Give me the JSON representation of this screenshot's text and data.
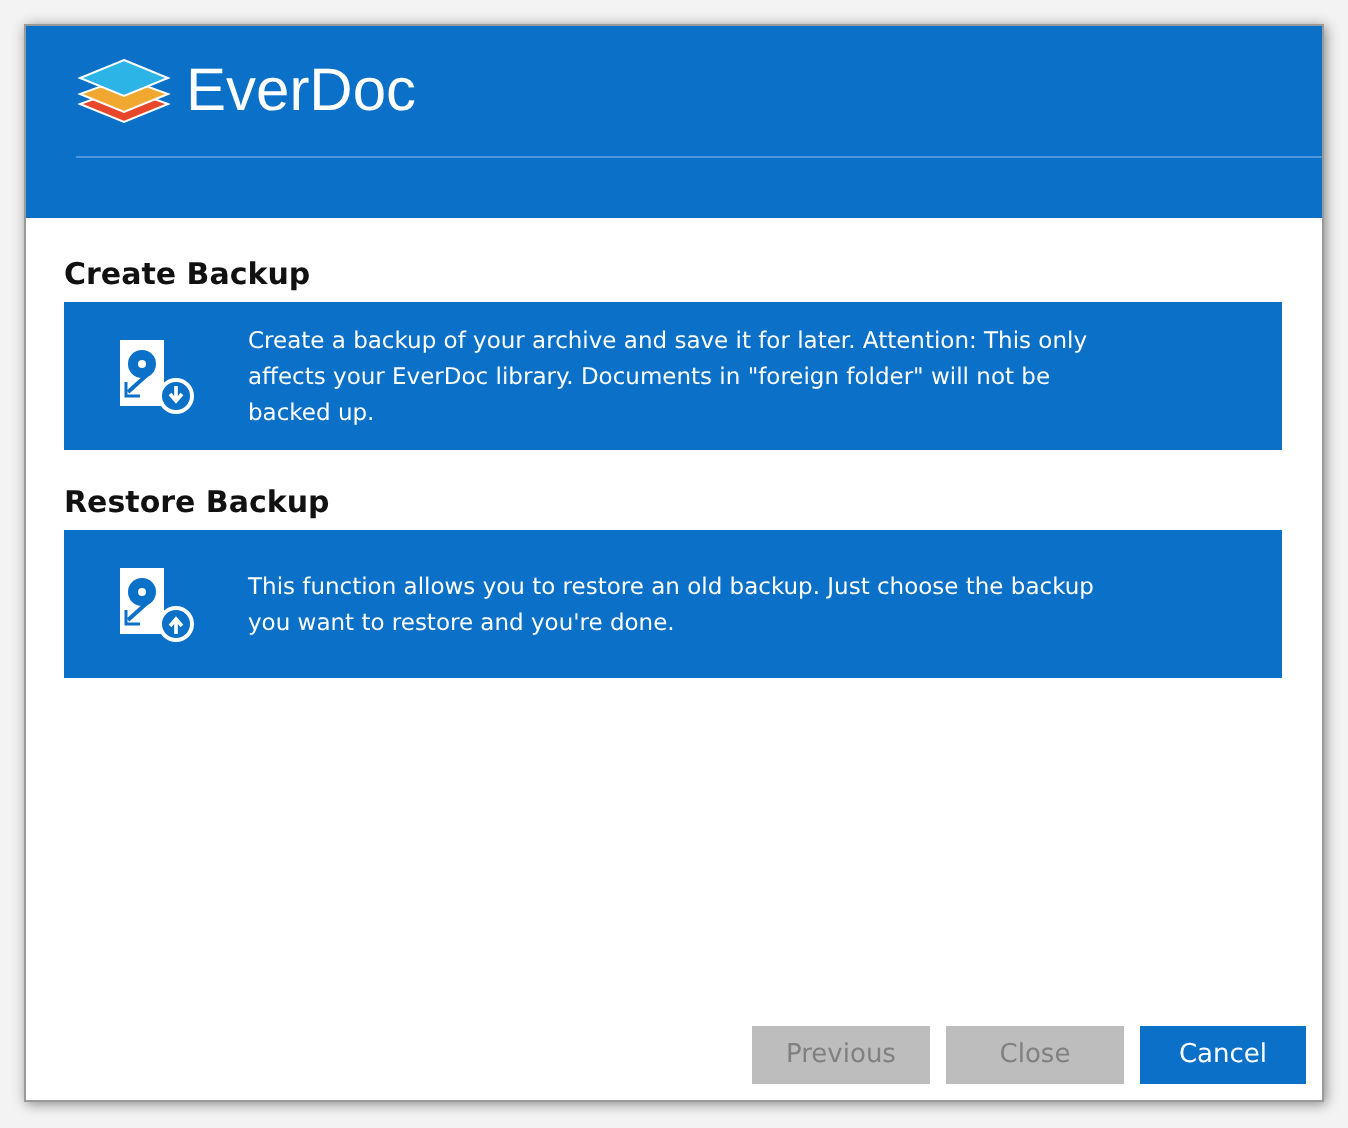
{
  "header": {
    "app_name": "EverDoc"
  },
  "sections": [
    {
      "kind": "backup",
      "title": "Create Backup",
      "description": "Create a backup of your archive and save it for later. Attention: This only affects your EverDoc library. Documents in \"foreign folder\" will not be backed up."
    },
    {
      "kind": "restore",
      "title": "Restore Backup",
      "description": "This function allows you to restore an old backup. Just choose the backup you want to restore and you're done."
    }
  ],
  "buttons": [
    {
      "label": "Previous",
      "disabled": true
    },
    {
      "label": "Close",
      "disabled": true
    },
    {
      "label": "Cancel",
      "disabled": false
    }
  ]
}
